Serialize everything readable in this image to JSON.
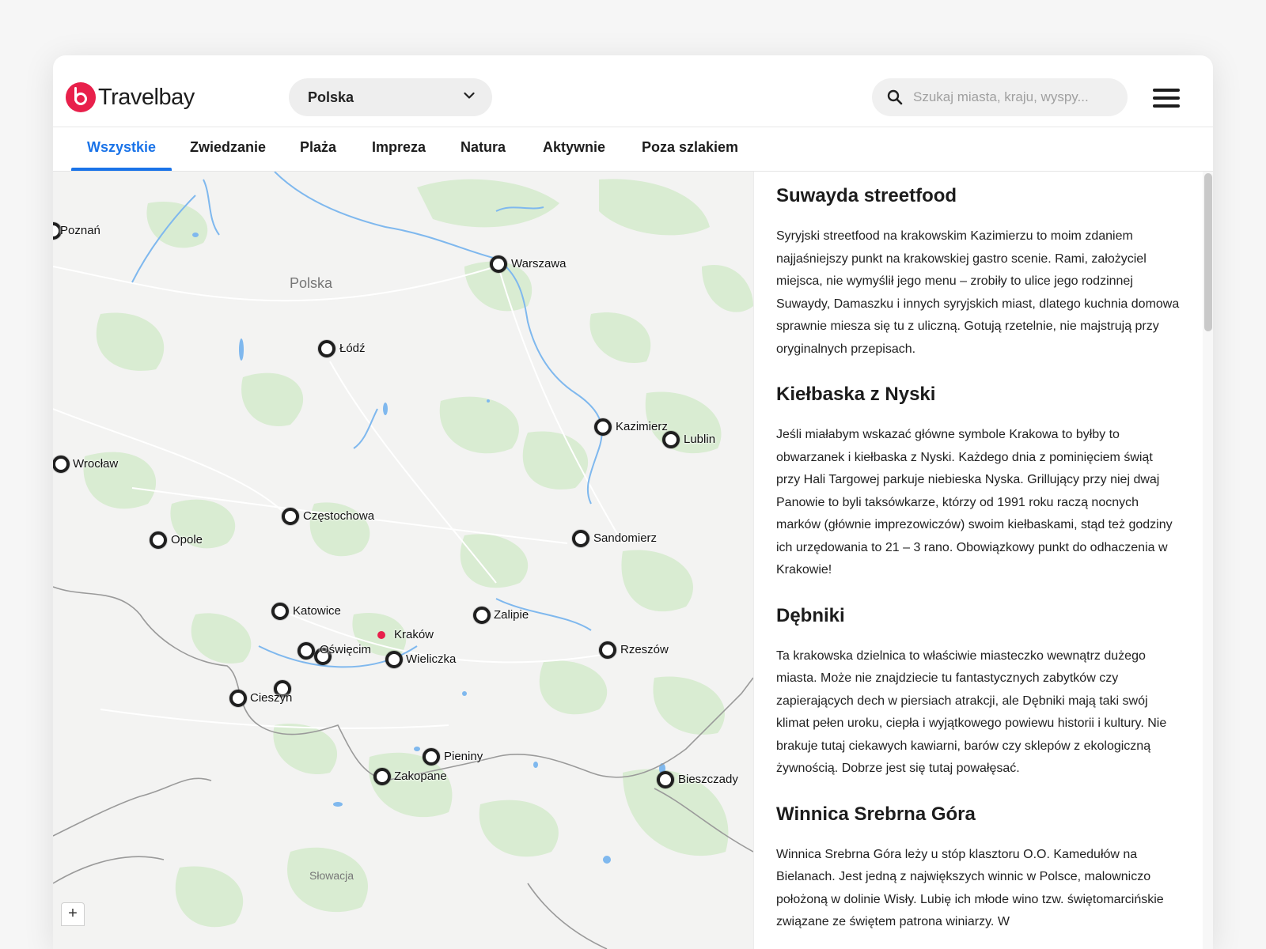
{
  "header": {
    "logo_text": "Travelbay",
    "country_select": {
      "value": "Polska"
    },
    "search": {
      "placeholder": "Szukaj miasta, kraju, wyspy..."
    }
  },
  "tabs": [
    {
      "label": "Wszystkie",
      "active": true
    },
    {
      "label": "Zwiedzanie"
    },
    {
      "label": "Plaża"
    },
    {
      "label": "Impreza"
    },
    {
      "label": "Natura"
    },
    {
      "label": "Aktywnie"
    },
    {
      "label": "Poza szlakiem"
    }
  ],
  "map": {
    "country_label": "Polska",
    "neighbor_label": "Słowacja",
    "zoom_in_label": "+",
    "markers": {
      "poznan": "Poznań",
      "warszawa": "Warszawa",
      "lodz": "Łódź",
      "kazimierz": "Kazimierz",
      "lublin": "Lublin",
      "wroclaw": "Wrocław",
      "czestochowa": "Częstochowa",
      "opole": "Opole",
      "sandomierz": "Sandomierz",
      "katowice": "Katowice",
      "krakow": "Kraków",
      "zalipie": "Zalipie",
      "oswiecim": "Oświęcim",
      "wieliczka": "Wieliczka",
      "rzeszow": "Rzeszów",
      "cieszyn": "Cieszyn",
      "pieniny": "Pieniny",
      "zakopane": "Zakopane",
      "bieszczady": "Bieszczady"
    }
  },
  "articles": [
    {
      "title": "Suwayda streetfood",
      "body": "Syryjski streetfood na krakowskim Kazimierzu to moim zdaniem najjaśniejszy punkt na krakowskiej gastro scenie. Rami, założyciel miejsca, nie wymyślił jego menu – zrobiły to ulice jego rodzinnej Suwaydy, Damaszku i innych syryjskich miast, dlatego kuchnia domowa  sprawnie miesza się tu z uliczną. Gotują rzetelnie, nie majstrują przy oryginalnych przepisach."
    },
    {
      "title": "Kiełbaska z Nyski",
      "body": "Jeśli miałabym wskazać główne symbole Krakowa to byłby to obwarzanek i kiełbaska z Nyski. Każdego dnia z pominięciem świąt przy Hali Targowej parkuje niebieska Nyska. Grillujący przy niej dwaj Panowie to byli taksówkarze, którzy od 1991 roku raczą nocnych marków (głównie imprezowiczów) swoim kiełbaskami, stąd też godziny ich urzędowania to 21 – 3 rano. Obowiązkowy punkt do odhaczenia w Krakowie!"
    },
    {
      "title": "Dębniki",
      "body": "Ta krakowska dzielnica to właściwie miasteczko wewnątrz dużego miasta. Może nie znajdziecie tu fantastycznych zabytków czy zapierających dech w piersiach atrakcji, ale Dębniki mają taki swój klimat pełen uroku, ciepła i wyjątkowego powiewu historii i kultury. Nie brakuje tutaj ciekawych kawiarni, barów czy sklepów z ekologiczną żywnością. Dobrze jest się tutaj powałęsać."
    },
    {
      "title": "Winnica Srebrna Góra",
      "body": "Winnica Srebrna Góra leży u stóp klasztoru O.O. Kamedułów na Bielanach. Jest jedną z największych winnic w Polsce, malowniczo położoną w dolinie Wisły. Lubię ich młode wino tzw. świętomarcińskie związane ze świętem patrona winiarzy. W"
    }
  ],
  "colors": {
    "brand": "#e8204b",
    "accent_tab": "#1a73e8",
    "map_land": "#f3f3f2",
    "map_forest": "#d9ecd2",
    "map_water": "#7fb8ee"
  }
}
